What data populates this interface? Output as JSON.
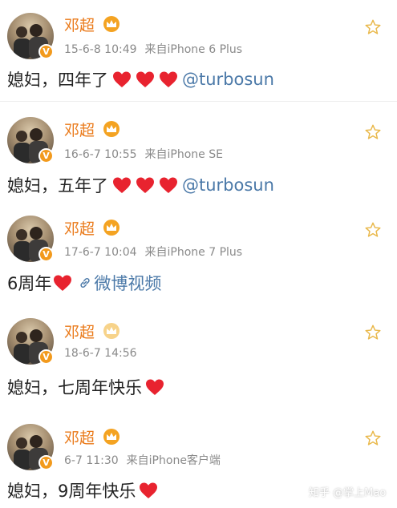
{
  "colors": {
    "username": "#ea7a1a",
    "meta": "#8a8a8a",
    "link": "#4b79a8",
    "heart": "#e8232f",
    "verified_badge": "#f29a1d",
    "star_outline": "#e9b84a"
  },
  "posts": [
    {
      "username": "邓超",
      "time": "15-6-8 10:49",
      "source": "来自iPhone 6 Plus",
      "text": "媳妇，四年了",
      "hearts": 3,
      "mention": "@turbosun",
      "link_label": ""
    },
    {
      "username": "邓超",
      "time": "16-6-7 10:55",
      "source": "来自iPhone SE",
      "text": "媳妇，五年了",
      "hearts": 3,
      "mention": "@turbosun",
      "link_label": ""
    },
    {
      "username": "邓超",
      "time": "17-6-7 10:04",
      "source": "来自iPhone 7 Plus",
      "text": "6周年",
      "hearts": 1,
      "mention": "",
      "link_label": "微博视频"
    },
    {
      "username": "邓超",
      "time": "18-6-7 14:56",
      "source": "",
      "text": "媳妇，七周年快乐",
      "hearts": 1,
      "mention": "",
      "link_label": ""
    },
    {
      "username": "邓超",
      "time": "6-7 11:30",
      "source": "来自iPhone客户端",
      "text": "媳妇，9周年快乐",
      "hearts": 1,
      "mention": "",
      "link_label": ""
    }
  ],
  "watermark": "知乎 @掌上Mao"
}
